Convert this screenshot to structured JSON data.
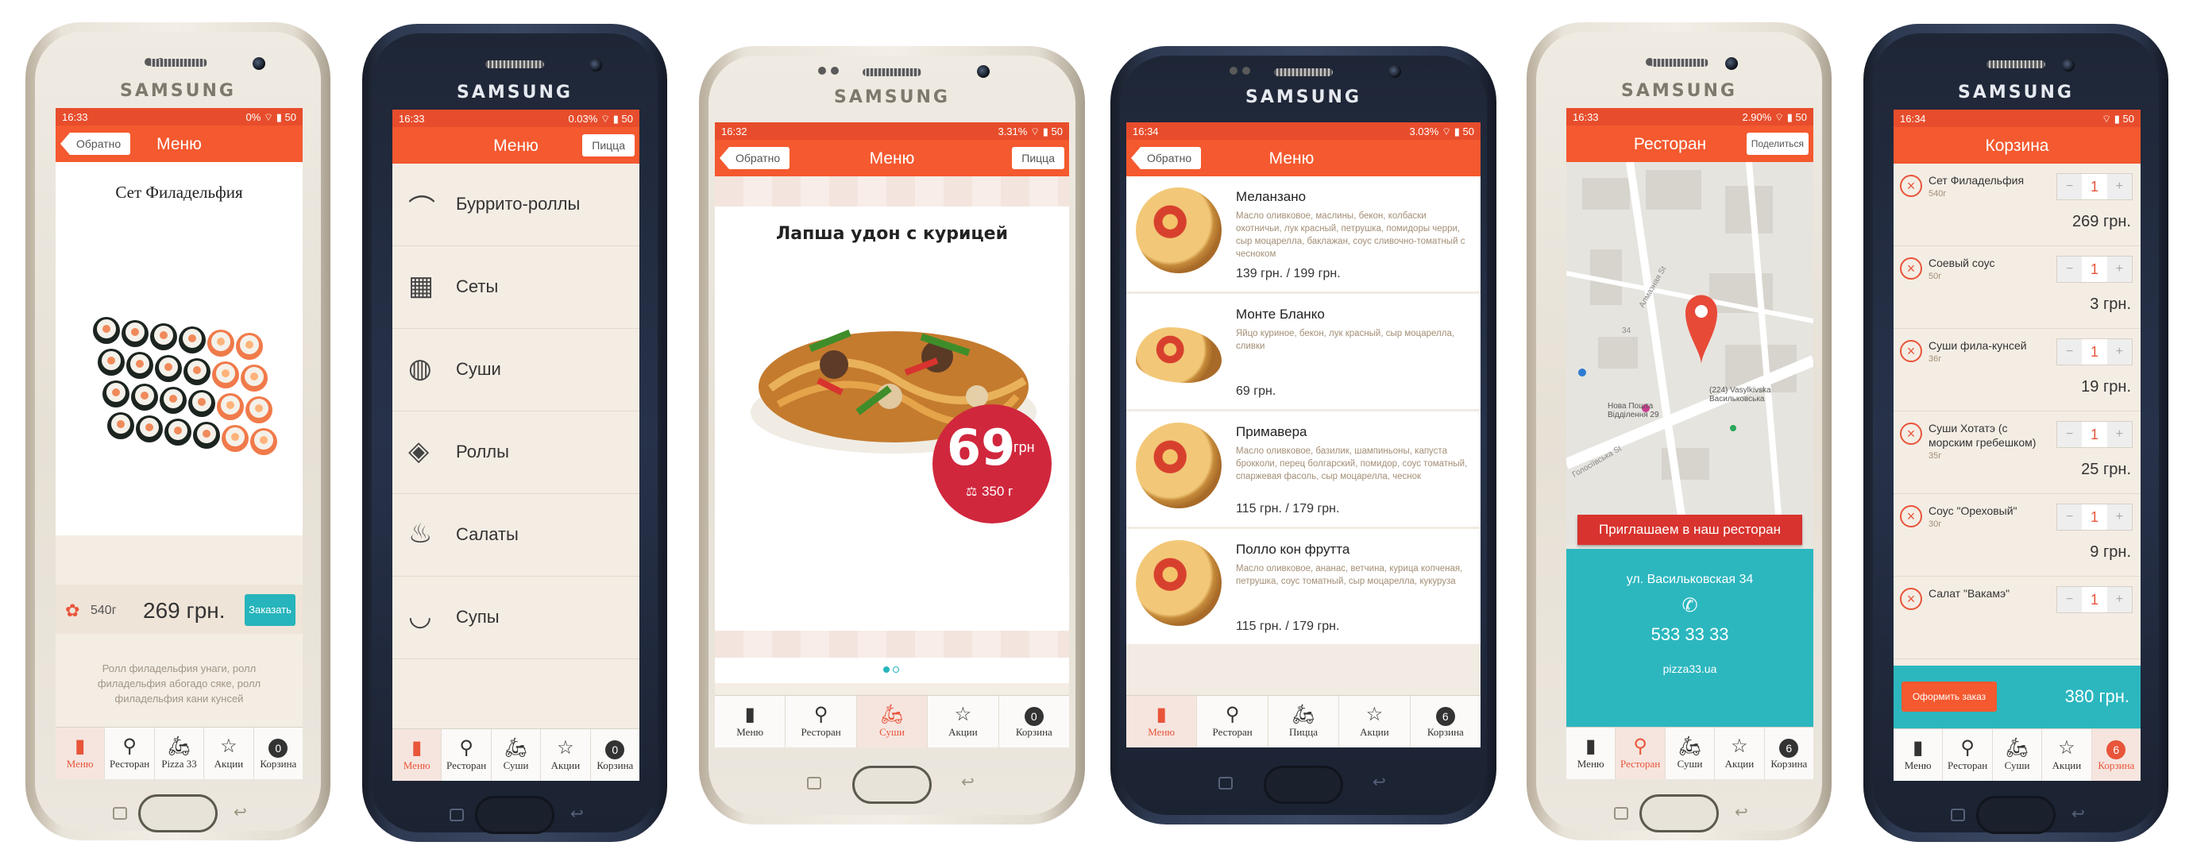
{
  "tabs_common": {
    "menu": "Меню",
    "restaurant": "Ресторан",
    "sushi": "Суши",
    "promos": "Акции",
    "cart": "Корзина",
    "pizza33": "Pizza 33",
    "pizza": "Пицца"
  },
  "phone1": {
    "brand": "SAMSUNG",
    "status_time": "16:33",
    "status_right": "0% ⌔ ▮ 50",
    "back": "Обратно",
    "title": "Меню",
    "product_title": "Сет Филадельфия",
    "weight": "540г",
    "price": "269 грн.",
    "order_button": "Заказать",
    "description": "Ролл филадельфия унаги, ролл филадельфия абогадо сяке, ролл филадельфия кани кунсей",
    "cart_count": "0"
  },
  "phone2": {
    "brand": "SAMSUNG",
    "status_time": "16:33",
    "status_right": "0.03% ⌔ ▮ 50",
    "title": "Меню",
    "right_button": "Пицца",
    "categories": [
      "Буррито-роллы",
      "Сеты",
      "Суши",
      "Роллы",
      "Салаты",
      "Супы"
    ],
    "cart_count": "0"
  },
  "phone3": {
    "brand": "SAMSUNG",
    "status_time": "16:32",
    "status_right": "3.31% ⌔ ▮ 50",
    "back": "Обратно",
    "title": "Меню",
    "right_button": "Пицца",
    "product_title": "Лапша удон с курицей",
    "price_value": "69",
    "price_unit": "грн",
    "weight": "350 г",
    "cart_count": "0"
  },
  "phone4": {
    "brand": "SAMSUNG",
    "status_time": "16:34",
    "status_right": "3.03% ⌔ ▮ 50",
    "back": "Обратно",
    "title": "Меню",
    "items": [
      {
        "name": "Меланзано",
        "desc": "Масло оливковое, маслины, бекон, колбаски охотничьи, лук красный, петрушка, помидоры черри, сыр моцарелла, баклажан, соус сливочно-томатный с чесноком",
        "price": "139 грн. / 199 грн."
      },
      {
        "name": "Монте Бланко",
        "desc": "Яйцо куриное, бекон, лук красный, сыр моцарелла, сливки",
        "price": "69 грн."
      },
      {
        "name": "Примавера",
        "desc": "Масло оливковое, базилик, шампиньоны, капуста брокколи, перец болгарский, помидор, соус томатный, спаржевая фасоль, сыр моцарелла, чеснок",
        "price": "115 грн. / 179 грн."
      },
      {
        "name": "Полло кон фрутта",
        "desc": "Масло оливковое, ананас, ветчина, курица копченая, петрушка, соус томатный, сыр моцарелла, кукуруза",
        "price": "115 грн. / 179 грн."
      }
    ],
    "cart_count": "6"
  },
  "phone5": {
    "brand": "SAMSUNG",
    "status_time": "16:33",
    "status_right": "2.90% ⌔ ▮ 50",
    "title": "Ресторан",
    "right_button": "Поделиться",
    "map_labels": {
      "street": "Алмазная St",
      "metro": "(224) Vasylkivska Васильковська",
      "post": "Нова Пошта Відділення 29",
      "street2": "Голосіївська St",
      "num": "34"
    },
    "ribbon": "Приглашаем в наш ресторан",
    "address": "ул. Васильковская 34",
    "phone": "533 33 33",
    "site": "pizza33.ua",
    "cart_count": "6"
  },
  "phone6": {
    "brand": "SAMSUNG",
    "status_time": "16:34",
    "status_right": "⌔ ▮ 50",
    "title": "Корзина",
    "items": [
      {
        "name": "Сет Филадельфия",
        "weight": "540г",
        "qty": "1",
        "price": "269 грн."
      },
      {
        "name": "Соевый соус",
        "weight": "50г",
        "qty": "1",
        "price": "3 грн."
      },
      {
        "name": "Суши фила-кунсей",
        "weight": "36г",
        "qty": "1",
        "price": "19 грн."
      },
      {
        "name": "Суши Хотатэ (с морским гребешком)",
        "weight": "35г",
        "qty": "1",
        "price": "25 грн."
      },
      {
        "name": "Соус \"Ореховый\"",
        "weight": "30г",
        "qty": "1",
        "price": "9 грн."
      },
      {
        "name": "Салат \"Вакамэ\"",
        "weight": "",
        "qty": "1",
        "price": ""
      }
    ],
    "checkout": "Оформить заказ",
    "total": "380 грн.",
    "cart_count": "6"
  },
  "colors": {
    "accent": "#f4592f",
    "teal": "#2cb7bf",
    "ribbon": "#d8332e",
    "cream": "#f4ede4"
  }
}
